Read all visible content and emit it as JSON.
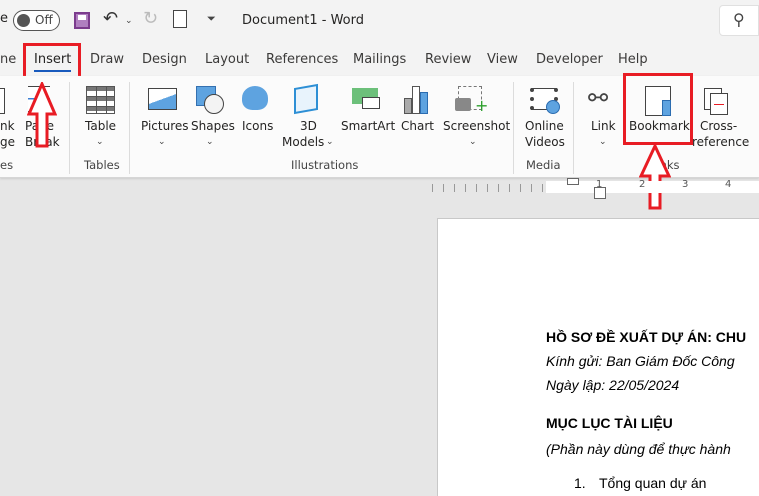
{
  "titlebar": {
    "autosave_partial": "e",
    "toggle": "Off",
    "doc_title": "Document1  -  Word"
  },
  "tabs": [
    {
      "label": "ne"
    },
    {
      "label": "Insert",
      "active": true
    },
    {
      "label": "Draw"
    },
    {
      "label": "Design"
    },
    {
      "label": "Layout"
    },
    {
      "label": "References"
    },
    {
      "label": "Mailings"
    },
    {
      "label": "Review"
    },
    {
      "label": "View"
    },
    {
      "label": "Developer"
    },
    {
      "label": "Help"
    }
  ],
  "ribbon": {
    "blank_page": [
      "nk",
      "ge"
    ],
    "page_break": [
      "Page",
      "Break"
    ],
    "table": "Table",
    "pictures": "Pictures",
    "shapes": "Shapes",
    "icons": "Icons",
    "models": [
      "3D",
      "Models"
    ],
    "smartart": "SmartArt",
    "chart": "Chart",
    "screenshot": "Screenshot",
    "online_videos": [
      "Online",
      "Videos"
    ],
    "link": "Link",
    "bookmark": "Bookmark",
    "cross_reference": [
      "Cross-",
      "reference"
    ],
    "groups": {
      "pages": "es",
      "tables": "Tables",
      "illustrations": "Illustrations",
      "media": "Media",
      "links": "Links"
    }
  },
  "ruler": {
    "marks": [
      "1",
      "2",
      "3",
      "4"
    ]
  },
  "document": {
    "line1": "HỒ SƠ ĐỀ XUẤT DỰ ÁN: CHU",
    "line2": "Kính gửi: Ban Giám Đốc Công",
    "line3": "Ngày lập: 22/05/2024",
    "heading": "MỤC LỤC TÀI LIỆU",
    "note": "(Phần này dùng để thực hành",
    "list": [
      {
        "num": "1.",
        "text": "Tổng quan dự án"
      }
    ]
  },
  "colors": {
    "highlight": "#e81c24",
    "accent": "#185abd"
  }
}
